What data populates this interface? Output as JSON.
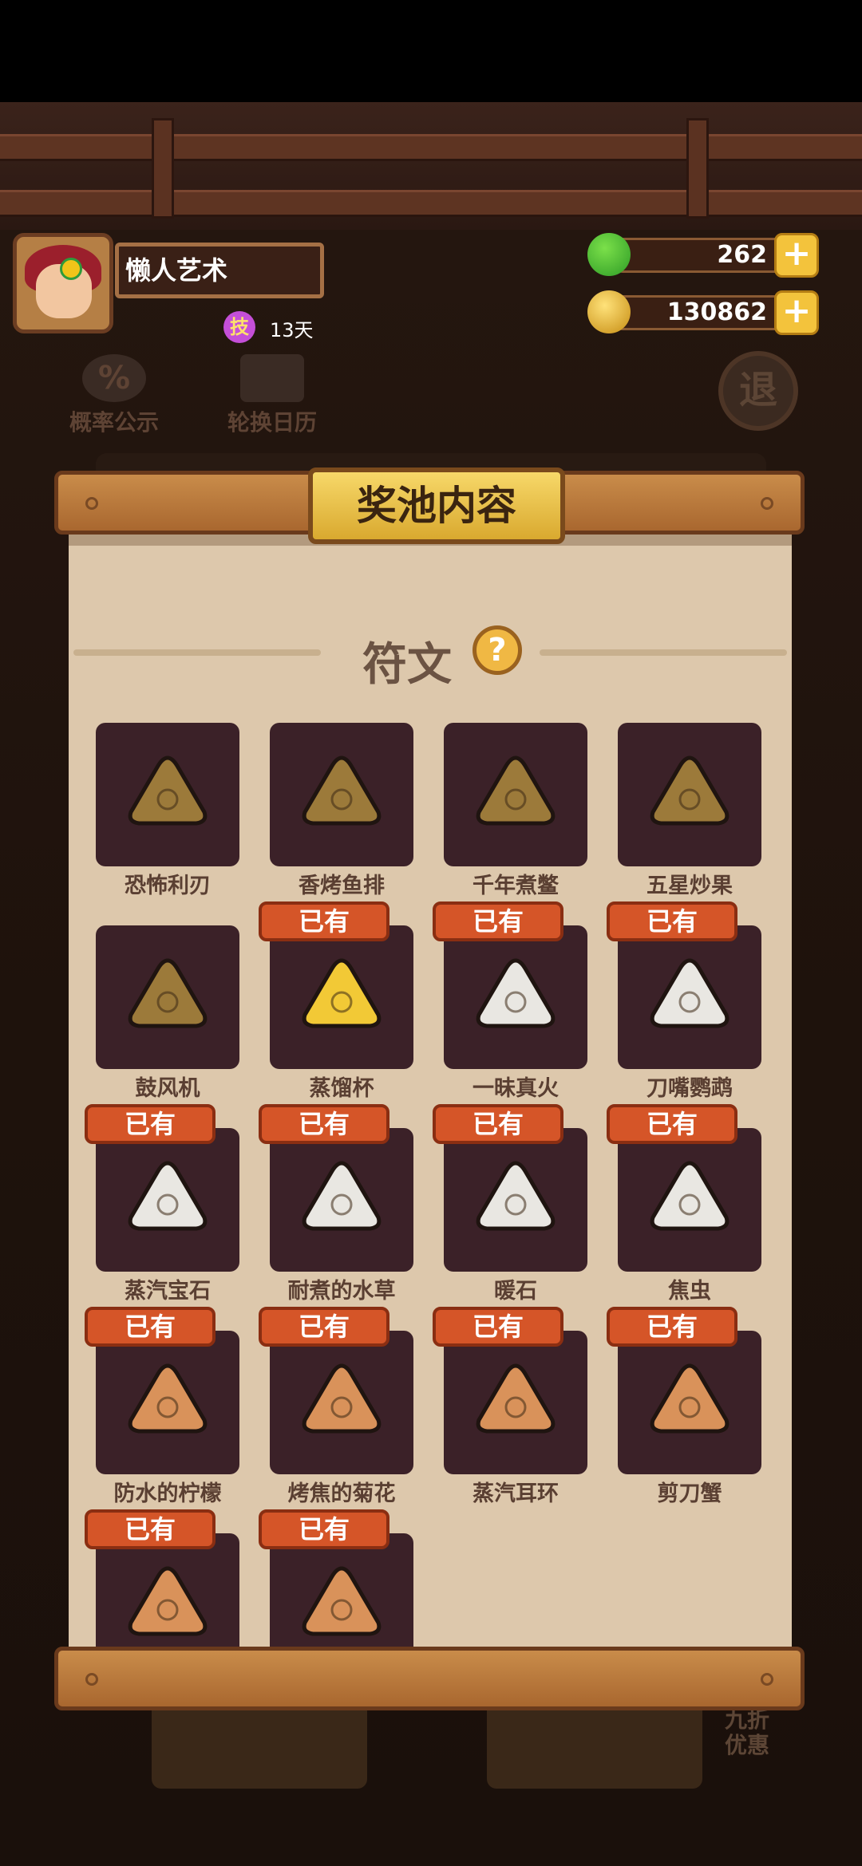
{
  "player": {
    "name": "懒人艺术",
    "skill_icon_label": "技",
    "skill_days": "13天"
  },
  "currency": {
    "jade": "262",
    "coins": "130862",
    "plus_label": "+"
  },
  "top_buttons": {
    "probability_label": "概率公示",
    "probability_icon": "%",
    "calendar_label": "轮换日历",
    "exit_label": "退"
  },
  "pool": {
    "title": "奖池内容",
    "section_title": "符文",
    "help_label": "?",
    "owned_label": "已有",
    "items": [
      {
        "name": "恐怖利刃",
        "owned": false,
        "color": "#9c7a3a"
      },
      {
        "name": "香烤鱼排",
        "owned": false,
        "color": "#9c7a3a"
      },
      {
        "name": "千年煮鳖",
        "owned": false,
        "color": "#9c7a3a"
      },
      {
        "name": "五星炒果",
        "owned": false,
        "color": "#9c7a3a"
      },
      {
        "name": "鼓风机",
        "owned": false,
        "color": "#9c7a3a"
      },
      {
        "name": "蒸馏杯",
        "owned": true,
        "color": "#f2c936"
      },
      {
        "name": "一昧真火",
        "owned": true,
        "color": "#e9e7e2"
      },
      {
        "name": "刀嘴鹦鹉",
        "owned": true,
        "color": "#e9e7e2"
      },
      {
        "name": "蒸汽宝石",
        "owned": true,
        "color": "#e9e7e2"
      },
      {
        "name": "耐煮的水草",
        "owned": true,
        "color": "#e9e7e2"
      },
      {
        "name": "暖石",
        "owned": true,
        "color": "#e9e7e2"
      },
      {
        "name": "焦虫",
        "owned": true,
        "color": "#e9e7e2"
      },
      {
        "name": "防水的柠檬",
        "owned": true,
        "color": "#d9925a"
      },
      {
        "name": "烤焦的菊花",
        "owned": true,
        "color": "#d9925a"
      },
      {
        "name": "蒸汽耳环",
        "owned": true,
        "color": "#d9925a"
      },
      {
        "name": "剪刀蟹",
        "owned": true,
        "color": "#d9925a"
      },
      {
        "name": "",
        "owned": true,
        "color": "#d9925a"
      },
      {
        "name": "",
        "owned": true,
        "color": "#d9925a"
      }
    ]
  },
  "bottom": {
    "discount_label": "九折优惠"
  }
}
